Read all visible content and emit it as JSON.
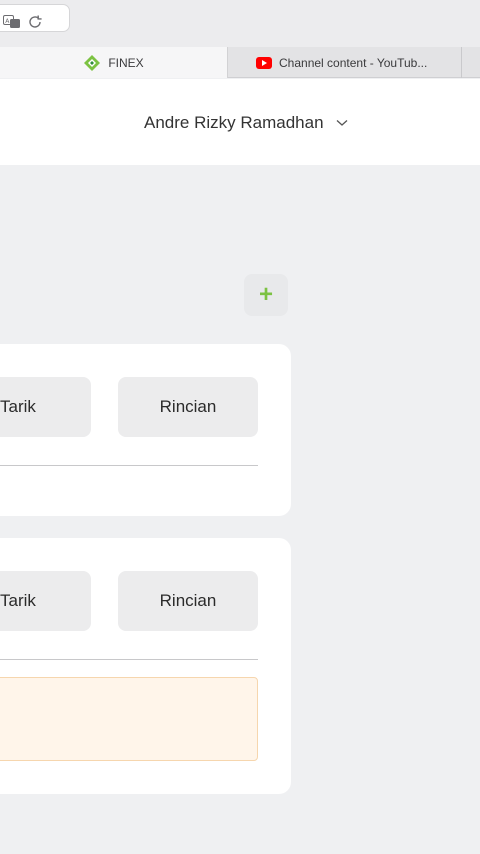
{
  "browser": {
    "tabs": [
      {
        "label": "FINEX",
        "active": true
      },
      {
        "label": "Channel content - YouTub..."
      }
    ]
  },
  "header": {
    "user_name": "Andre Rizky Ramadhan"
  },
  "actions": {
    "add_symbol": "+"
  },
  "cards": [
    {
      "withdraw_label": "Tarik",
      "details_label": "Rincian"
    },
    {
      "withdraw_label": "Tarik",
      "details_label": "Rincian"
    }
  ],
  "colors": {
    "accent_green": "#7cc242",
    "notice_bg": "#fff5ea",
    "notice_border": "#f6d6ae"
  }
}
